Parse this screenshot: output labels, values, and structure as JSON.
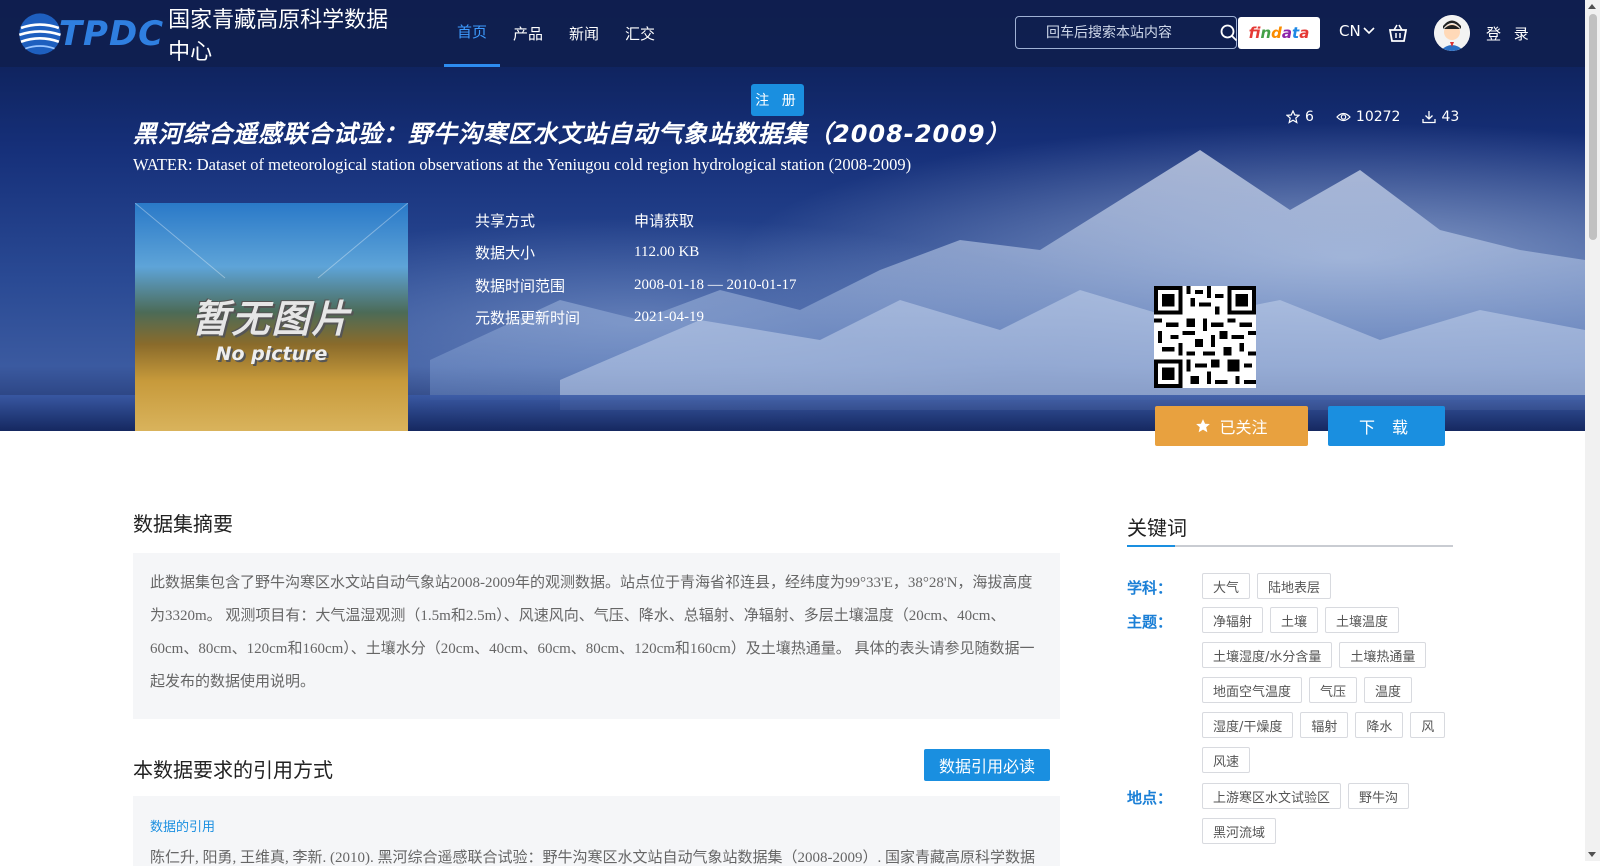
{
  "header": {
    "logo_text": "TPDC",
    "logo_name": "国家青藏高原科学数据中心",
    "nav": [
      {
        "label": "首页"
      },
      {
        "label": "产品"
      },
      {
        "label": "新闻"
      },
      {
        "label": "汇交"
      }
    ],
    "search_placeholder": "回车后搜索本站内容",
    "findata_label": "findata",
    "lang": "CN",
    "login": "登 录",
    "register": "注 册"
  },
  "dataset": {
    "title": "黑河综合遥感联合试验：野牛沟寒区水文站自动气象站数据集（2008-2009）",
    "subtitle": "WATER: Dataset of meteorological station observations at the Yeniugou cold region hydrological station (2008-2009)",
    "stats": {
      "stars": "6",
      "views": "10272",
      "downloads": "43"
    },
    "thumbnail": {
      "line1": "暂无图片",
      "line2": "No picture"
    },
    "meta": [
      {
        "label": "共享方式",
        "value": "申请获取"
      },
      {
        "label": "数据大小",
        "value": "112.00 KB"
      },
      {
        "label": "数据时间范围",
        "value": "2008-01-18 — 2010-01-17"
      },
      {
        "label": "元数据更新时间",
        "value": "2021-04-19"
      }
    ],
    "follow_label": "已关注",
    "download_label": "下 载"
  },
  "abstract": {
    "heading": "数据集摘要",
    "text": "此数据集包含了野牛沟寒区水文站自动气象站2008-2009年的观测数据。站点位于青海省祁连县，经纬度为99°33'E，38°28'N，海拔高度为3320m。 观测项目有：大气温湿观测（1.5m和2.5m）、风速风向、气压、降水、总辐射、净辐射、多层土壤温度（20cm、40cm、60cm、80cm、120cm和160cm）、土壤水分（20cm、40cm、60cm、80cm、120cm和160cm）及土壤热通量。 具体的表头请参见随数据一起发布的数据使用说明。"
  },
  "citation": {
    "heading": "本数据要求的引用方式",
    "must_read": "数据引用必读",
    "label": "数据的引用",
    "text": "陈仁升, 阳勇, 王维真, 李新. (2010). 黑河综合遥感联合试验：野牛沟寒区水文站自动气象站数据集（2008-2009）. 国家青藏高原科学数据"
  },
  "keywords": {
    "heading": "关键词",
    "groups": [
      {
        "label": "学科：",
        "tags": [
          "大气",
          "陆地表层"
        ]
      },
      {
        "label": "主题：",
        "tags": [
          "净辐射",
          "土壤",
          "土壤温度",
          "土壤湿度/水分含量",
          "土壤热通量",
          "地面空气温度",
          "气压",
          "温度",
          "湿度/干燥度",
          "辐射",
          "降水",
          "风",
          "风速"
        ]
      },
      {
        "label": "地点：",
        "tags": [
          "上游寒区水文试验区",
          "野牛沟",
          "黑河流域"
        ]
      }
    ]
  },
  "colors": {
    "accent": "#1a8fe0",
    "follow": "#e8a13f",
    "header": "#0f1f4f"
  }
}
